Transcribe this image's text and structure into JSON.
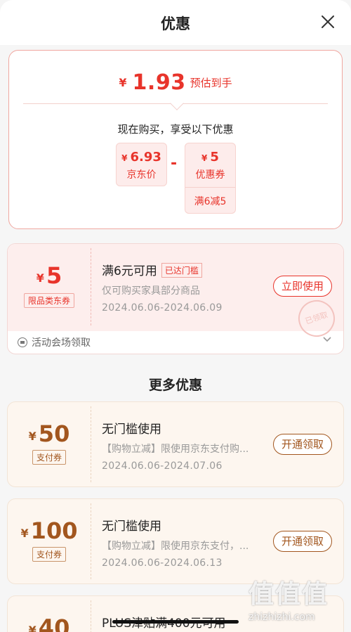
{
  "header": {
    "title": "优惠"
  },
  "summary": {
    "currency": "¥",
    "final_price": "1.93",
    "final_label": "预估到手",
    "buy_now_text": "现在购买，享受以下优惠",
    "jd_price": {
      "value": "6.93",
      "label": "京东价"
    },
    "coupon": {
      "value": "5",
      "label": "优惠券",
      "condition": "满6减5"
    }
  },
  "coupons": [
    {
      "value": "5",
      "tag": "限品类东券",
      "title": "满6元可用",
      "badge": "已达门槛",
      "desc": "仅可购买家具部分商品",
      "date": "2024.06.06-2024.06.09",
      "button": "立即使用",
      "source": "活动会场领取",
      "stamp": "已领取"
    },
    {
      "value": "50",
      "tag": "支付券",
      "title": "无门槛使用",
      "desc": "【购物立减】限使用京东支付购...",
      "date": "2024.06.06-2024.07.06",
      "button": "开通领取"
    },
    {
      "value": "100",
      "tag": "支付券",
      "title": "无门槛使用",
      "desc": "【购物立减】限使用京东支付，...",
      "date": "2024.06.06-2024.06.13",
      "button": "开通领取"
    },
    {
      "value": "40",
      "title": "PLUS津贴满400元可用"
    }
  ],
  "more_title": "更多优惠",
  "watermark": {
    "logo": "值值值",
    "url": "zhizhizhi.com"
  },
  "colors": {
    "accent_red": "#e8342b",
    "accent_gold": "#a2561e"
  }
}
